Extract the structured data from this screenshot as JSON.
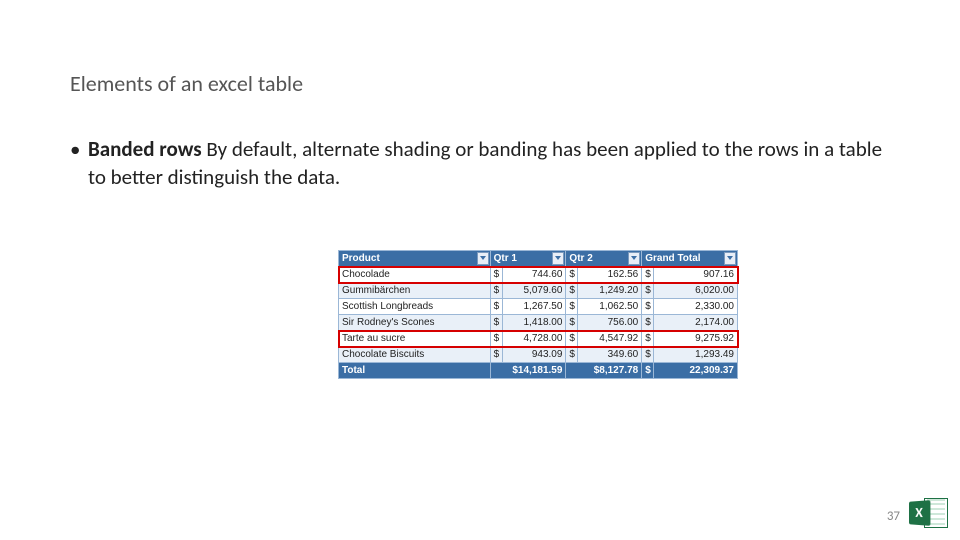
{
  "title": "Elements of an excel table",
  "bullet": {
    "label_bold": "Banded rows",
    "text_rest": "   By default, alternate shading or banding has been applied to the rows in a table to better distinguish the data."
  },
  "table": {
    "headers": [
      "Product",
      "Qtr 1",
      "Qtr 2",
      "Grand Total"
    ],
    "currency": "$",
    "rows": [
      {
        "product": "Chocolade",
        "q1": "744.60",
        "q2": "162.56",
        "gt": "907.16"
      },
      {
        "product": "Gummibärchen",
        "q1": "5,079.60",
        "q2": "1,249.20",
        "gt": "6,020.00"
      },
      {
        "product": "Scottish Longbreads",
        "q1": "1,267.50",
        "q2": "1,062.50",
        "gt": "2,330.00"
      },
      {
        "product": "Sir Rodney's Scones",
        "q1": "1,418.00",
        "q2": "756.00",
        "gt": "2,174.00"
      },
      {
        "product": "Tarte au sucre",
        "q1": "4,728.00",
        "q2": "4,547.92",
        "gt": "9,275.92"
      },
      {
        "product": "Chocolate Biscuits",
        "q1": "943.09",
        "q2": "349.60",
        "gt": "1,293.49"
      }
    ],
    "totals": {
      "label": "Total",
      "q1": "$14,181.59",
      "q2": "$8,127.78",
      "gt": "22,309.37"
    }
  },
  "page_number": "37",
  "excel_badge": "X"
}
